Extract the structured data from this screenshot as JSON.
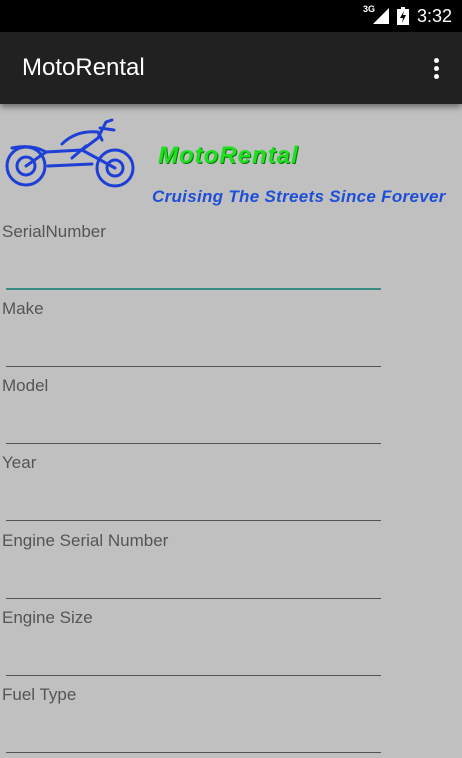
{
  "status_bar": {
    "network": "3G",
    "time": "3:32"
  },
  "app_bar": {
    "title": "MotoRental",
    "menu_icon": "overflow-menu-icon"
  },
  "banner": {
    "logo_icon": "motorcycle-icon",
    "brand": "MotoRental",
    "tagline": "Cruising The Streets Since Forever",
    "brand_color": "#1fe01f",
    "tagline_color": "#1e4fd6"
  },
  "form": {
    "fields": [
      {
        "label": "SerialNumber",
        "value": "",
        "focused": true
      },
      {
        "label": "Make",
        "value": ""
      },
      {
        "label": "Model",
        "value": ""
      },
      {
        "label": "Year",
        "value": ""
      },
      {
        "label": "Engine Serial Number",
        "value": ""
      },
      {
        "label": "Engine Size",
        "value": ""
      },
      {
        "label": "Fuel Type",
        "value": ""
      }
    ]
  },
  "colors": {
    "background": "#c0c0c0",
    "app_bar": "#212121",
    "accent": "#3a8a84"
  }
}
